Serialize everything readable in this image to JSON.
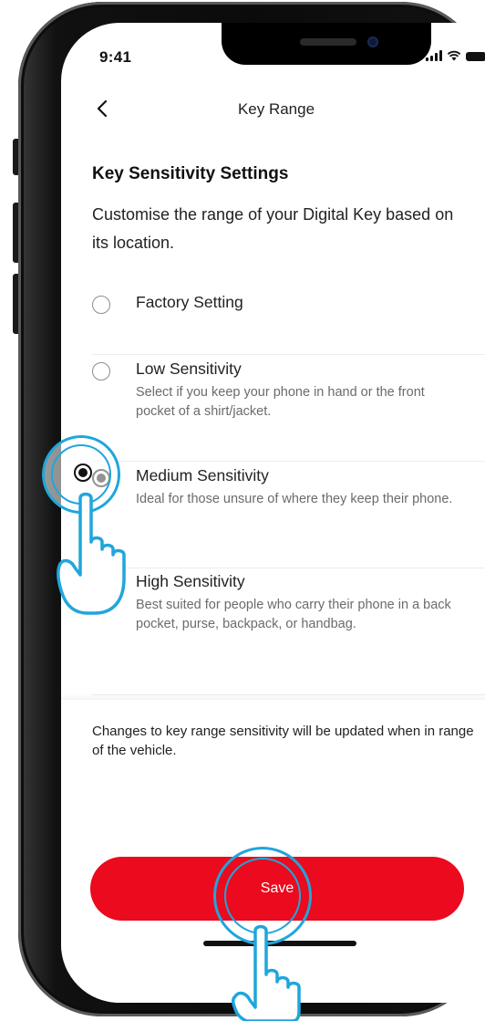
{
  "status_bar": {
    "time": "9:41"
  },
  "nav": {
    "title": "Key Range",
    "back_icon": "chevron-left-icon"
  },
  "section": {
    "title": "Key Sensitivity Settings",
    "description": "Customise the range of your Digital Key based on its location."
  },
  "options": [
    {
      "label": "Factory Setting",
      "description": "",
      "selected": false
    },
    {
      "label": "Low Sensitivity",
      "description": "Select if you keep your phone in hand or the front pocket of a shirt/jacket.",
      "selected": false
    },
    {
      "label": "Medium Sensitivity",
      "description": "Ideal for those unsure of where they keep their phone.",
      "selected": true
    },
    {
      "label": "High Sensitivity",
      "description": "Best suited for people who carry their phone in a back pocket, purse, backpack, or handbag.",
      "selected": false
    }
  ],
  "footer": {
    "note": "Changes to key range sensitivity will be updated when in range of the vehicle.",
    "save_label": "Save"
  },
  "colors": {
    "accent": "#eb0a1e",
    "tap_indicator": "#1fa6dc",
    "text_primary": "#111111",
    "text_secondary": "#6b6b6b"
  },
  "icons": [
    "chevron-left-icon",
    "signal-icon",
    "wifi-icon",
    "battery-icon",
    "radio-icon",
    "tap-hand-icon"
  ]
}
